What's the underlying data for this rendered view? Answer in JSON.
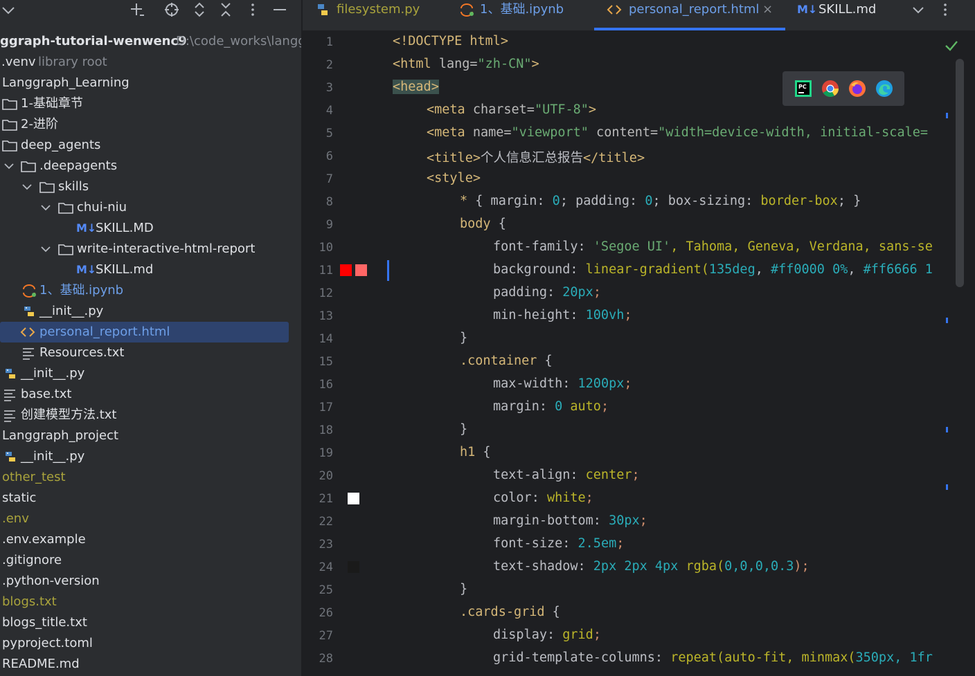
{
  "project": {
    "root_name": "ggraph-tutorial-wenwenc9",
    "root_path": "D:\\code_works\\langg",
    "items": [
      {
        "label": ".venv",
        "extra": "library root"
      },
      {
        "label": "Langgraph_Learning"
      },
      {
        "label": "1-基础章节"
      },
      {
        "label": "2-进阶"
      },
      {
        "label": "deep_agents"
      },
      {
        "label": ".deepagents"
      },
      {
        "label": "skills"
      },
      {
        "label": "chui-niu"
      },
      {
        "label": "SKILL.MD"
      },
      {
        "label": "write-interactive-html-report"
      },
      {
        "label": "SKILL.md"
      },
      {
        "label": "1、基础.ipynb"
      },
      {
        "label": "__init__.py"
      },
      {
        "label": "personal_report.html"
      },
      {
        "label": "Resources.txt"
      },
      {
        "label": "__init__.py"
      },
      {
        "label": "base.txt"
      },
      {
        "label": "创建模型方法.txt"
      },
      {
        "label": "Langgraph_project"
      },
      {
        "label": "__init__.py"
      },
      {
        "label": "other_test"
      },
      {
        "label": "static"
      },
      {
        "label": ".env"
      },
      {
        "label": ".env.example"
      },
      {
        "label": ".gitignore"
      },
      {
        "label": ".python-version"
      },
      {
        "label": "blogs.txt"
      },
      {
        "label": "blogs_title.txt"
      },
      {
        "label": "pyproject.toml"
      },
      {
        "label": "README.md"
      }
    ]
  },
  "tabs": [
    {
      "label": "filesystem.py"
    },
    {
      "label": "1、基础.ipynb"
    },
    {
      "label": "personal_report.html",
      "close": "×"
    },
    {
      "label": "SKILL.md",
      "badge": "M↓"
    }
  ],
  "editor": {
    "line_numbers": [
      "1",
      "2",
      "3",
      "4",
      "5",
      "6",
      "7",
      "8",
      "9",
      "10",
      "11",
      "12",
      "13",
      "14",
      "15",
      "16",
      "17",
      "18",
      "19",
      "20",
      "21",
      "22",
      "23",
      "24",
      "25",
      "26",
      "27",
      "28"
    ],
    "lines": {
      "l1": {
        "t1": "<!DOCTYPE html>"
      },
      "l2": {
        "t1": "<html ",
        "t2": "lang=",
        "t3": "\"zh-CN\"",
        "t4": ">"
      },
      "l3": {
        "t1": "<head>"
      },
      "l4": {
        "t1": "<meta ",
        "t2": "charset=",
        "t3": "\"UTF-8\"",
        "t4": ">"
      },
      "l5": {
        "t1": "<meta ",
        "t2": "name=",
        "t3": "\"viewport\"",
        "t4": " content=",
        "t5": "\"width=device-width, initial-scale="
      },
      "l6": {
        "t1": "<title>",
        "t2": "个人信息汇总报告",
        "t3": "</title>"
      },
      "l7": {
        "t1": "<style>"
      },
      "l8": {
        "t1": "* ",
        "t2": "{ margin: ",
        "t3": "0",
        "t4": "; padding: ",
        "t5": "0",
        "t6": "; box-sizing: ",
        "t7": "border-box",
        "t8": "; }"
      },
      "l9": {
        "t1": "body ",
        "t2": "{"
      },
      "l10": {
        "t1": "font-family: ",
        "t2": "'Segoe UI'",
        "t3": ", Tahoma, Geneva, Verdana, sans-se"
      },
      "l11": {
        "t1": "background: ",
        "t2": "linear-gradient(",
        "t3": "135deg",
        "t4": ", ",
        "t5": "#ff0000 0%",
        "t6": ", ",
        "t7": "#ff6666 1"
      },
      "l12": {
        "t1": "padding: ",
        "t2": "20px",
        "t3": ";"
      },
      "l13": {
        "t1": "min-height: ",
        "t2": "100vh",
        "t3": ";"
      },
      "l14": {
        "t1": "}"
      },
      "l15": {
        "t1": ".container ",
        "t2": "{"
      },
      "l16": {
        "t1": "max-width: ",
        "t2": "1200px",
        "t3": ";"
      },
      "l17": {
        "t1": "margin: ",
        "t2": "0",
        "t3": " auto",
        "t4": ";"
      },
      "l18": {
        "t1": "}"
      },
      "l19": {
        "t1": "h1 ",
        "t2": "{"
      },
      "l20": {
        "t1": "text-align: ",
        "t2": "center",
        "t3": ";"
      },
      "l21": {
        "t1": "color: ",
        "t2": "white",
        "t3": ";"
      },
      "l22": {
        "t1": "margin-bottom: ",
        "t2": "30px",
        "t3": ";"
      },
      "l23": {
        "t1": "font-size: ",
        "t2": "2.5em",
        "t3": ";"
      },
      "l24": {
        "t1": "text-shadow: ",
        "t2": "2px 2px 4px ",
        "t3": "rgba(",
        "t4": "0,0,0,0.3",
        "t5": ");"
      },
      "l25": {
        "t1": "}"
      },
      "l26": {
        "t1": ".cards-grid ",
        "t2": "{"
      },
      "l27": {
        "t1": "display: ",
        "t2": "grid",
        "t3": ";"
      },
      "l28": {
        "t1": "grid-template-columns: ",
        "t2": "repeat(",
        "t3": "auto-fit",
        "t4": ", minmax(",
        "t5": "350px",
        "t6": ", 1fr"
      }
    }
  },
  "colors": {
    "accent": "#3574f0",
    "swatch_red": "#ff0000",
    "swatch_light_red": "#ff6666",
    "swatch_white": "#ffffff",
    "swatch_dark": "#1a1a1a"
  },
  "icons": {
    "toolbar": [
      "chevron-down-icon",
      "add-icon",
      "locate-icon",
      "expand-icon",
      "collapse-icon",
      "more-icon",
      "minimize-icon"
    ],
    "browsers": [
      "pycharm-icon",
      "chrome-icon",
      "firefox-icon",
      "edge-icon"
    ]
  }
}
